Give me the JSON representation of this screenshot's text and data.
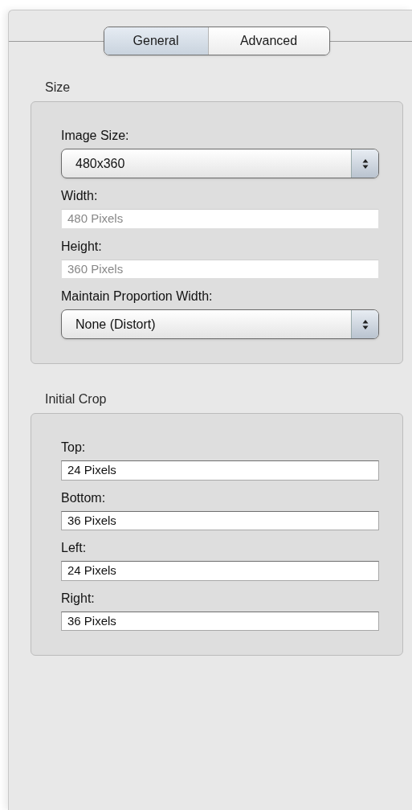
{
  "tabs": [
    {
      "label": "General",
      "selected": true
    },
    {
      "label": "Advanced",
      "selected": false
    }
  ],
  "groups": [
    {
      "title": "Size",
      "controls": [
        {
          "kind": "popup",
          "label": "Image Size:",
          "value": "480x360"
        },
        {
          "kind": "field",
          "label": "Width:",
          "placeholder": "480 Pixels",
          "disabled": true
        },
        {
          "kind": "field",
          "label": "Height:",
          "placeholder": "360 Pixels",
          "disabled": true
        },
        {
          "kind": "popup",
          "label": "Maintain Proportion Width:",
          "value": "None (Distort)"
        }
      ]
    },
    {
      "title": "Initial Crop",
      "controls": [
        {
          "kind": "field",
          "label": "Top:",
          "value": "24 Pixels",
          "disabled": false
        },
        {
          "kind": "field",
          "label": "Bottom:",
          "value": "36 Pixels",
          "disabled": false
        },
        {
          "kind": "field",
          "label": "Left:",
          "value": "24 Pixels",
          "disabled": false
        },
        {
          "kind": "field",
          "label": "Right:",
          "value": "36 Pixels",
          "disabled": false
        }
      ]
    }
  ]
}
